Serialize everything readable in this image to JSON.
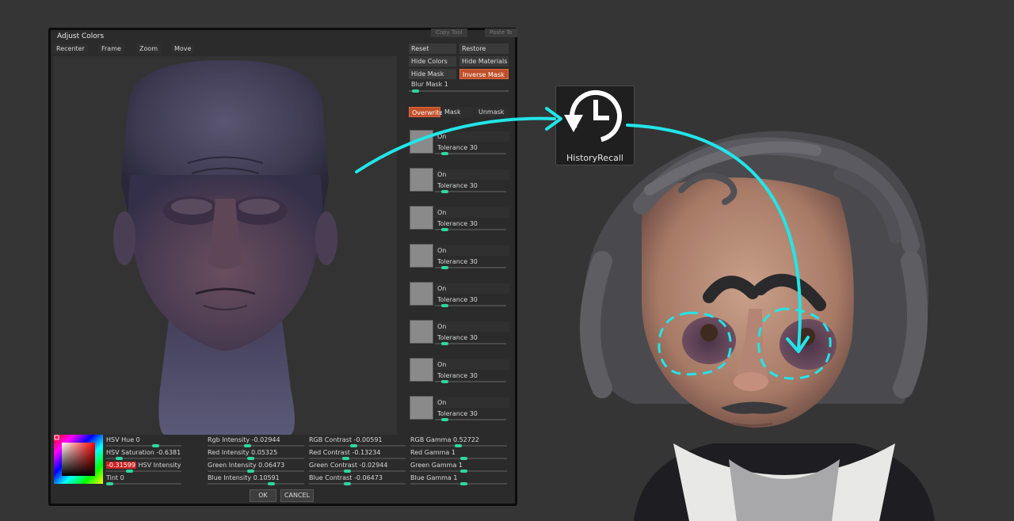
{
  "dialog": {
    "title": "Adjust Colors",
    "ghost_buttons": [
      "Copy Tool",
      "Paste To"
    ],
    "toolbar": [
      "Recenter",
      "Frame",
      "Zoom",
      "Move"
    ]
  },
  "right_panel": {
    "reset": "Reset",
    "restore": "Restore",
    "hide_colors": "Hide Colors",
    "hide_materials": "Hide Materials",
    "hide_mask": "Hide Mask",
    "inverse_mask": "Inverse Mask",
    "blur_mask": "Blur Mask 1",
    "overwrite": "Overwrite",
    "mask": "Mask",
    "unmask": "Unmask",
    "color_rows": [
      {
        "on": "On",
        "tolerance": "Tolerance 30"
      },
      {
        "on": "On",
        "tolerance": "Tolerance 30"
      },
      {
        "on": "On",
        "tolerance": "Tolerance 30"
      },
      {
        "on": "On",
        "tolerance": "Tolerance 30"
      },
      {
        "on": "On",
        "tolerance": "Tolerance 30"
      },
      {
        "on": "On",
        "tolerance": "Tolerance 30"
      },
      {
        "on": "On",
        "tolerance": "Tolerance 30"
      },
      {
        "on": "On",
        "tolerance": "Tolerance 30"
      }
    ]
  },
  "params": {
    "col1": [
      {
        "label": "HSV Hue",
        "value": "0"
      },
      {
        "label": "HSV Saturation",
        "value": "-0.6381"
      },
      {
        "label": "HSV Intensity",
        "value": "-0.31599"
      },
      {
        "label": "Tint",
        "value": "0"
      }
    ],
    "col2": [
      {
        "label": "Rgb Intensity",
        "value": "-0.02944"
      },
      {
        "label": "Red Intensity",
        "value": "0.05325"
      },
      {
        "label": "Green Intensity",
        "value": "0.06473"
      },
      {
        "label": "Blue Intensity",
        "value": "0.10591"
      }
    ],
    "col3": [
      {
        "label": "RGB Contrast",
        "value": "-0.00591"
      },
      {
        "label": "Red Contrast",
        "value": "-0.13234"
      },
      {
        "label": "Green Contrast",
        "value": "-0.02944"
      },
      {
        "label": "Blue Contrast",
        "value": "-0.06473"
      }
    ],
    "col4": [
      {
        "label": "RGB Gamma",
        "value": "0.52722"
      },
      {
        "label": "Red Gamma",
        "value": "1"
      },
      {
        "label": "Green Gamma",
        "value": "1"
      },
      {
        "label": "Blue Gamma",
        "value": "1"
      }
    ]
  },
  "footer": {
    "ok": "OK",
    "cancel": "CANCEL"
  },
  "history_recall": {
    "label": "HistoryRecall",
    "icon": "history-recall-icon"
  },
  "colors": {
    "accent_active": "#c0502a",
    "slider_knob": "#2fd6a0",
    "annotation": "#22e5e8"
  }
}
